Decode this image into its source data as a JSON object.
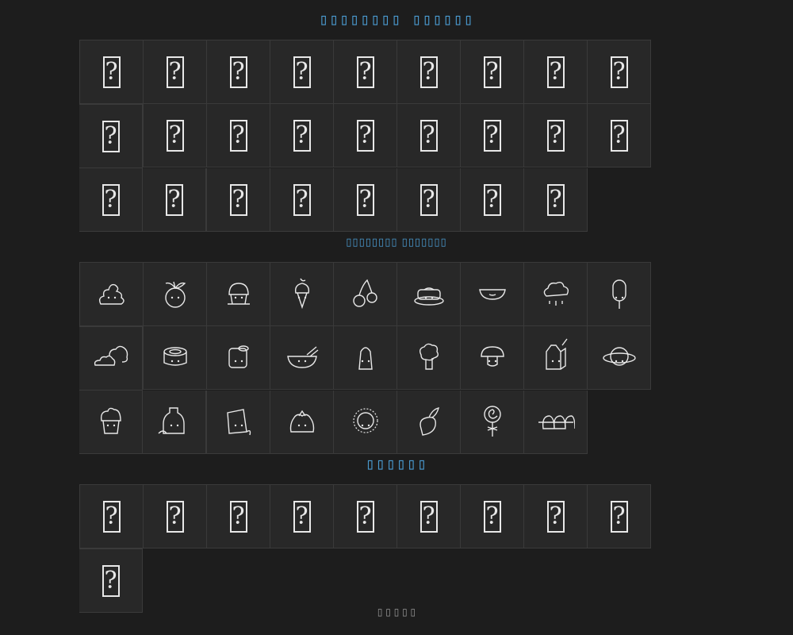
{
  "sections": {
    "section1_title": "▯▯▯▯▯▯▯▯ ▯▯▯▯▯▯",
    "section2_title": "▯▯▯▯▯▯▯▯ ▯▯▯▯▯▯▯",
    "section3_title": "▯▯▯▯▯▯"
  },
  "footer_text": "▯ ▯ ▯ ▯ ▯",
  "missing_glyph": "?",
  "grid1_count": 26,
  "grid3_count": 10,
  "icons": [
    "poop-icon",
    "apple-icon",
    "muffin-icon",
    "ice-cream-cone-icon",
    "cherries-icon",
    "pancakes-icon",
    "watermelon-icon",
    "rain-cloud-icon",
    "popsicle-icon",
    "clouds-icon",
    "sushi-roll-icon",
    "toilet-paper-icon",
    "bowl-icon",
    "salt-shaker-icon",
    "broccoli-icon",
    "mushroom-icon",
    "milk-carton-icon",
    "planet-icon",
    "cupcake-icon",
    "bottle-icon",
    "tea-bag-icon",
    "money-bag-icon",
    "sun-icon",
    "turnip-icon",
    "lollipop-icon",
    "dango-icon"
  ],
  "colors": {
    "background": "#1d1d1d",
    "cell": "#282828",
    "accent": "#4a9bd1",
    "icon": "#e8e8e8"
  }
}
